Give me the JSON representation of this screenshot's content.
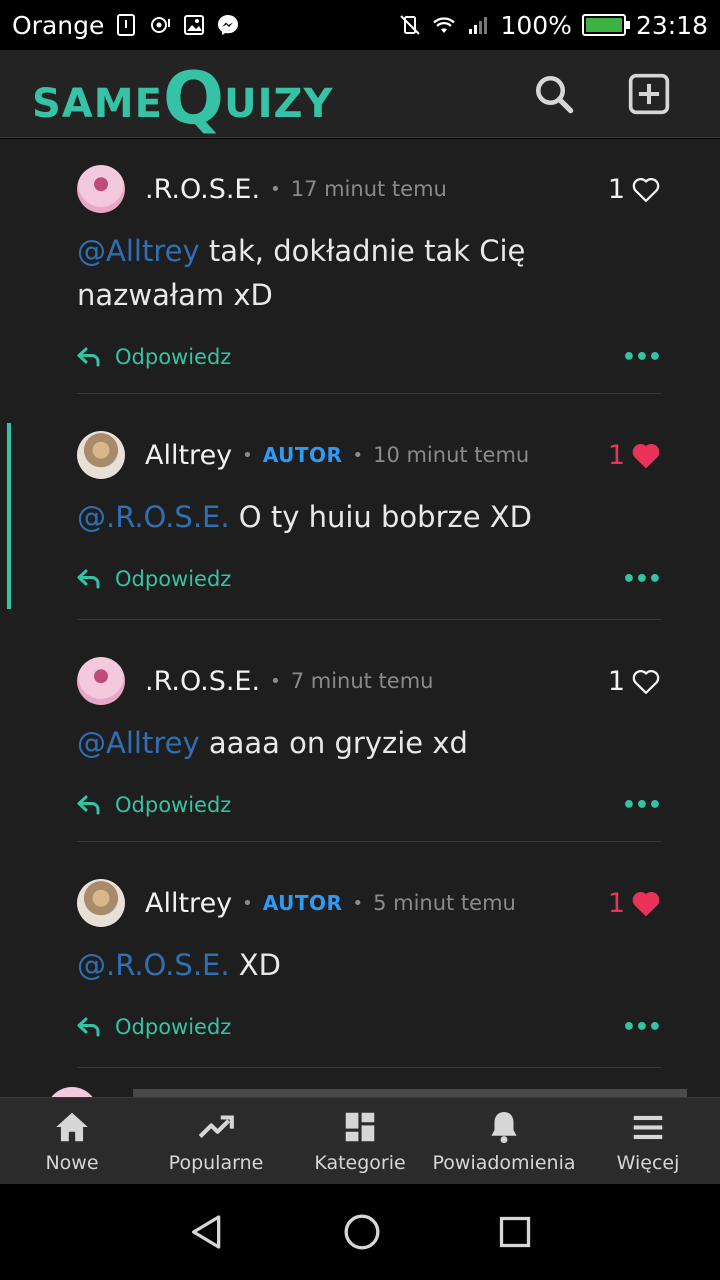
{
  "status_bar": {
    "carrier": "Orange",
    "battery": "100%",
    "battery_level": 1.0,
    "time": "23:18"
  },
  "header": {
    "logo_same": "SAME",
    "logo_q": "Q",
    "logo_uizy": "UIZY"
  },
  "colors": {
    "accent": "#35c2a5",
    "author_badge": "#2e9bf0",
    "liked_heart": "#e8325a",
    "mention": "#2f6fb3"
  },
  "comments": [
    {
      "name": ".R.O.S.E.",
      "time": "17 minut temu",
      "likes": "1",
      "liked": false,
      "mention": "@Alltrey",
      "text": " tak, dokładnie tak Cię nazwałam xD",
      "reply": "Odpowiedz"
    },
    {
      "name": "Alltrey",
      "badge": "AUTOR",
      "time": "10 minut temu",
      "likes": "1",
      "liked": true,
      "mention": "@.R.O.S.E.",
      "text": " O ty huiu bobrze XD",
      "reply": "Odpowiedz"
    },
    {
      "name": ".R.O.S.E.",
      "time": "7 minut temu",
      "likes": "1",
      "liked": false,
      "mention": "@Alltrey",
      "text": " aaaa on gryzie xd",
      "reply": "Odpowiedz"
    },
    {
      "name": "Alltrey",
      "badge": "AUTOR",
      "time": "5 minut temu",
      "likes": "1",
      "liked": true,
      "mention": "@.R.O.S.E.",
      "text": " XD",
      "reply": "Odpowiedz"
    }
  ],
  "bottom_nav": [
    {
      "label": "Nowe",
      "icon": "home-icon"
    },
    {
      "label": "Popularne",
      "icon": "trending-icon"
    },
    {
      "label": "Kategorie",
      "icon": "categories-icon"
    },
    {
      "label": "Powiadomienia",
      "icon": "bell-icon"
    },
    {
      "label": "Więcej",
      "icon": "menu-icon"
    }
  ]
}
